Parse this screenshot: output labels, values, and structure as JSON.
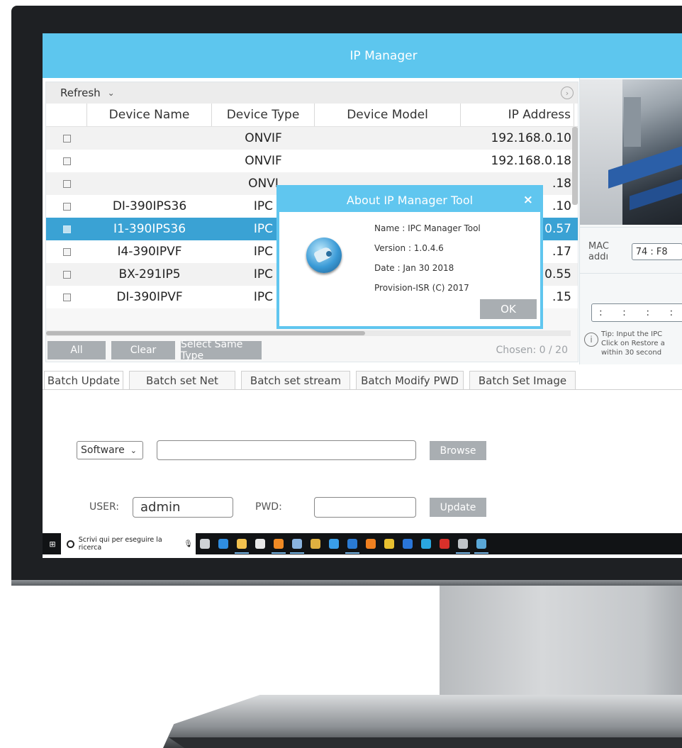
{
  "window": {
    "title": "IP Manager"
  },
  "toolbar": {
    "refresh_label": "Refresh",
    "refresh_chevron": "⌄",
    "expand_icon": "›"
  },
  "table": {
    "columns": [
      "Device Name",
      "Device Type",
      "Device Model",
      "IP Address"
    ],
    "rows": [
      {
        "name": "",
        "type": "ONVIF",
        "model": "",
        "ip": "192.168.0.10",
        "selected": false
      },
      {
        "name": "",
        "type": "ONVIF",
        "model": "",
        "ip": "192.168.0.18",
        "selected": false
      },
      {
        "name": "",
        "type": "ONVI",
        "model": "",
        "ip": ".18",
        "selected": false
      },
      {
        "name": "DI-390IPS36",
        "type": "IPC",
        "model": "",
        "ip": ".10",
        "selected": false
      },
      {
        "name": "I1-390IPS36",
        "type": "IPC",
        "model": "",
        "ip": "0.57",
        "selected": true
      },
      {
        "name": "I4-390IPVF",
        "type": "IPC",
        "model": "",
        "ip": ".17",
        "selected": false
      },
      {
        "name": "BX-291IP5",
        "type": "IPC",
        "model": "",
        "ip": "0.55",
        "selected": false
      },
      {
        "name": "DI-390IPVF",
        "type": "IPC",
        "model": "",
        "ip": ".15",
        "selected": false
      }
    ]
  },
  "selection": {
    "all_label": "All",
    "clear_label": "Clear",
    "same_type_label": "Select Same Type",
    "chosen_text": "Chosen:  0  / 20"
  },
  "right_panel": {
    "mac_label": "MAC addı",
    "mac_value": "74 : F8",
    "ip_value": ":  :  :  :",
    "tip_lines": [
      "Tip: Input the IPC",
      "Click on Restore a",
      "within 30 second"
    ]
  },
  "tabs": [
    "Batch Update",
    "Batch set Net",
    "Batch set stream",
    "Batch Modify PWD",
    "Batch Set Image"
  ],
  "update": {
    "select_value": "Software",
    "browse_label": "Browse",
    "user_label": "USER:",
    "user_value": "admin",
    "pwd_label": "PWD:",
    "update_label": "Update"
  },
  "modal": {
    "title": "About IP Manager Tool",
    "close": "×",
    "name": "Name : IPC Manager Tool",
    "version": "Version : 1.0.4.6",
    "date": "Date : Jan 30 2018",
    "copyright": "Provision-ISR (C) 2017",
    "ok_label": "OK"
  },
  "taskbar": {
    "search_placeholder": "Scrivi qui per eseguire la ricerca",
    "apps": [
      {
        "name": "task-view-icon",
        "color": "#cfd3d6"
      },
      {
        "name": "edge-icon",
        "color": "#2f8de0"
      },
      {
        "name": "file-explorer-icon",
        "color": "#f2c14e"
      },
      {
        "name": "store-icon",
        "color": "#e8e8e8"
      },
      {
        "name": "firefox-icon",
        "color": "#f08a24"
      },
      {
        "name": "app-icon",
        "color": "#8ab4e0"
      },
      {
        "name": "folder-icon",
        "color": "#e0b040"
      },
      {
        "name": "ie-icon",
        "color": "#3a9ee8"
      },
      {
        "name": "outlook-icon",
        "color": "#2a7bd4"
      },
      {
        "name": "vlc-icon",
        "color": "#f08020"
      },
      {
        "name": "chrome-icon",
        "color": "#e8c030"
      },
      {
        "name": "teamviewer-icon",
        "color": "#2a76d8"
      },
      {
        "name": "skype-icon",
        "color": "#2aa7e0"
      },
      {
        "name": "acrobat-icon",
        "color": "#d8302a"
      },
      {
        "name": "camera-app-icon",
        "color": "#c0c4c8"
      },
      {
        "name": "ip-manager-icon",
        "color": "#5aa8d8"
      }
    ]
  },
  "colors": {
    "accent": "#5dc6ee",
    "selected_row": "#3aa2d4",
    "button_gray": "#a9aeb2"
  }
}
